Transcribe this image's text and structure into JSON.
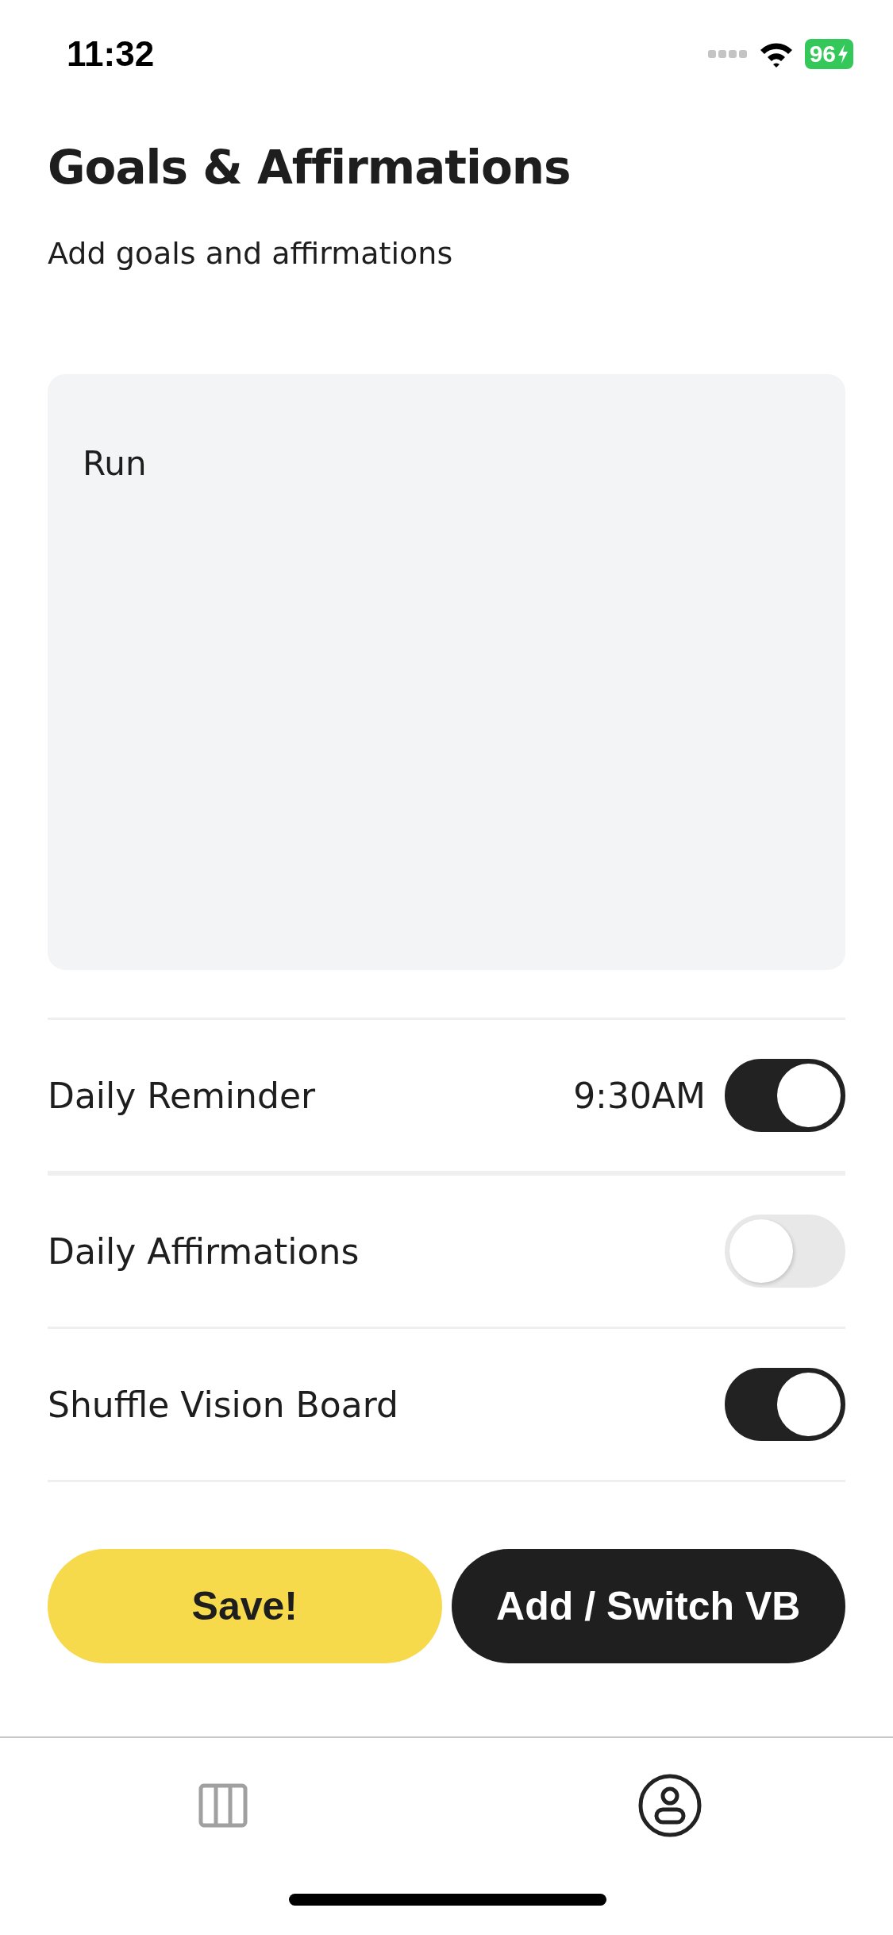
{
  "status_bar": {
    "time": "11:32",
    "battery": "96"
  },
  "title": "Goals & Affirmations",
  "subtitle": "Add goals and affirmations",
  "goals_field": {
    "value": "Run"
  },
  "settings": [
    {
      "label": "Daily Reminder",
      "time": "9:30AM",
      "on": true
    },
    {
      "label": "Daily Affirmations",
      "on": false
    },
    {
      "label": "Shuffle Vision Board",
      "on": true
    }
  ],
  "buttons": [
    {
      "label": "Save!",
      "kind": "primary"
    },
    {
      "label": "Add / Switch VB",
      "kind": "dark"
    }
  ],
  "tab_bar": [
    {
      "kind": "boards",
      "selected": false
    },
    {
      "kind": "profile",
      "selected": true
    }
  ]
}
